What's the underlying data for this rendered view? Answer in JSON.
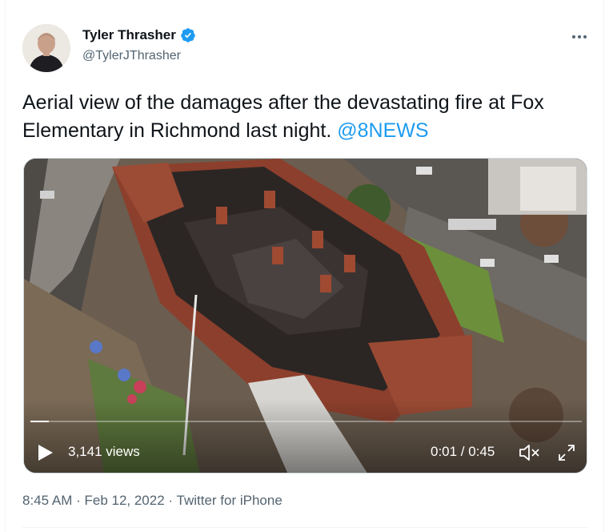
{
  "tweet": {
    "author_name": "Tyler Thrasher",
    "author_handle": "@TylerJThrasher",
    "text_before_mention": "Aerial view of the damages after the devastating fire at Fox Elementary in Richmond last night. ",
    "mention": "@8NEWS",
    "icons": {
      "verified": "verified-badge-icon",
      "more": "more-options-icon"
    }
  },
  "video": {
    "views_label": "3,141 views",
    "time_label": "0:01 / 0:45",
    "progress_fraction": 0.033,
    "icons": {
      "play": "play-icon",
      "mute": "mute-icon",
      "fullscreen": "fullscreen-icon"
    }
  },
  "meta": {
    "time": "8:45 AM",
    "separator": " · ",
    "date": "Feb 12, 2022",
    "source": "Twitter for iPhone"
  },
  "colors": {
    "accent": "#1d9bf0",
    "secondary_text": "#536471"
  }
}
